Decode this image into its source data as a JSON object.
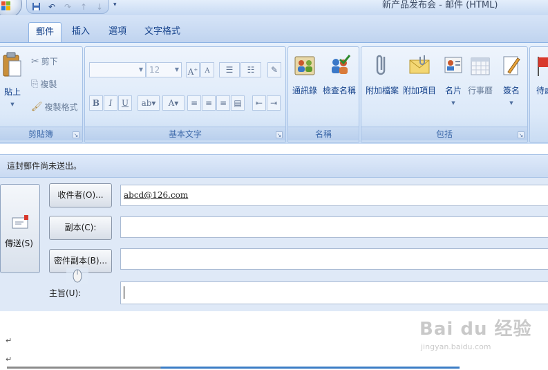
{
  "window": {
    "title": "新产品发布会 - 邮件 (HTML)"
  },
  "quick_access": {
    "items": [
      "save-icon",
      "undo-icon",
      "redo-icon",
      "arrow-up-icon",
      "arrow-down-icon"
    ],
    "more": "▾"
  },
  "tabs": [
    {
      "label": "郵件",
      "active": true
    },
    {
      "label": "插入",
      "active": false
    },
    {
      "label": "選項",
      "active": false
    },
    {
      "label": "文字格式",
      "active": false
    }
  ],
  "ribbon": {
    "clipboard": {
      "label": "剪貼簿",
      "paste": "貼上",
      "cut": "剪下",
      "copy": "複製",
      "format_painter": "複製格式"
    },
    "basic_text": {
      "label": "基本文字",
      "font_name": "",
      "font_size": "12"
    },
    "names": {
      "label": "名稱",
      "address_book": "通訊錄",
      "check_names": "檢查名稱"
    },
    "include": {
      "label": "包括",
      "attach_file": "附加檔案",
      "attach_item": "附加項目",
      "business_card": "名片",
      "calendar": "行事曆",
      "signature": "簽名"
    },
    "follow_up": {
      "label": "待處"
    }
  },
  "infobar": {
    "text": "這封郵件尚未送出。"
  },
  "header": {
    "send_label": "傳送(S)",
    "to_button": "收件者(O)...",
    "cc_button": "副本(C):",
    "bcc_button": "密件副本(B)...",
    "subject_label": "主旨(U):",
    "to_value": "abcd@126.com",
    "cc_value": "",
    "bcc_value": "",
    "subject_value": ""
  },
  "body": {
    "paragraph_mark": "↵"
  },
  "watermark": {
    "main": "Bai du 经验",
    "sub": "jingyan.baidu.com"
  },
  "colors": {
    "ribbon_text": "#15428b",
    "accent_blue": "#3b7dc5"
  }
}
